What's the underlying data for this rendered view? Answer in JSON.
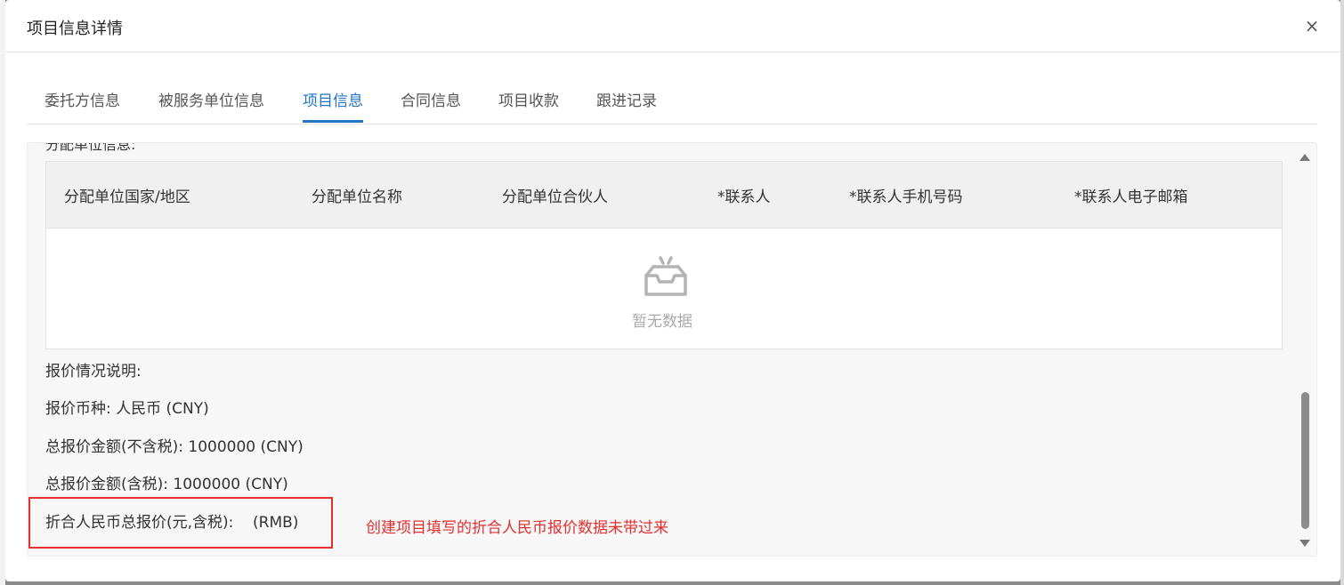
{
  "dialog": {
    "title": "项目信息详情",
    "close_label": "×"
  },
  "tabs": [
    {
      "label": "委托方信息"
    },
    {
      "label": "被服务单位信息"
    },
    {
      "label": "项目信息"
    },
    {
      "label": "合同信息"
    },
    {
      "label": "项目收款"
    },
    {
      "label": "跟进记录"
    }
  ],
  "active_tab": "项目信息",
  "section": {
    "title": "分配单位信息:"
  },
  "table": {
    "columns": [
      "分配单位国家/地区",
      "分配单位名称",
      "分配单位合伙人",
      "*联系人",
      "*联系人手机号码",
      "*联系人电子邮箱"
    ],
    "rows": [],
    "empty_text": "暂无数据"
  },
  "quote": {
    "description_label": "报价情况说明:",
    "currency_line": "报价币种: 人民币 (CNY)",
    "total_excl_tax_line": "总报价金额(不含税): 1000000 (CNY)",
    "total_incl_tax_line": "总报价金额(含税): 1000000 (CNY)",
    "rmb_total_line": "折合人民币总报价(元,含税):    (RMB)"
  },
  "annotation": {
    "text": "创建项目填写的折合人民币报价数据未带过来",
    "color": "#e03030"
  },
  "colors": {
    "accent": "#1f75c4",
    "annotation": "#e03030"
  }
}
